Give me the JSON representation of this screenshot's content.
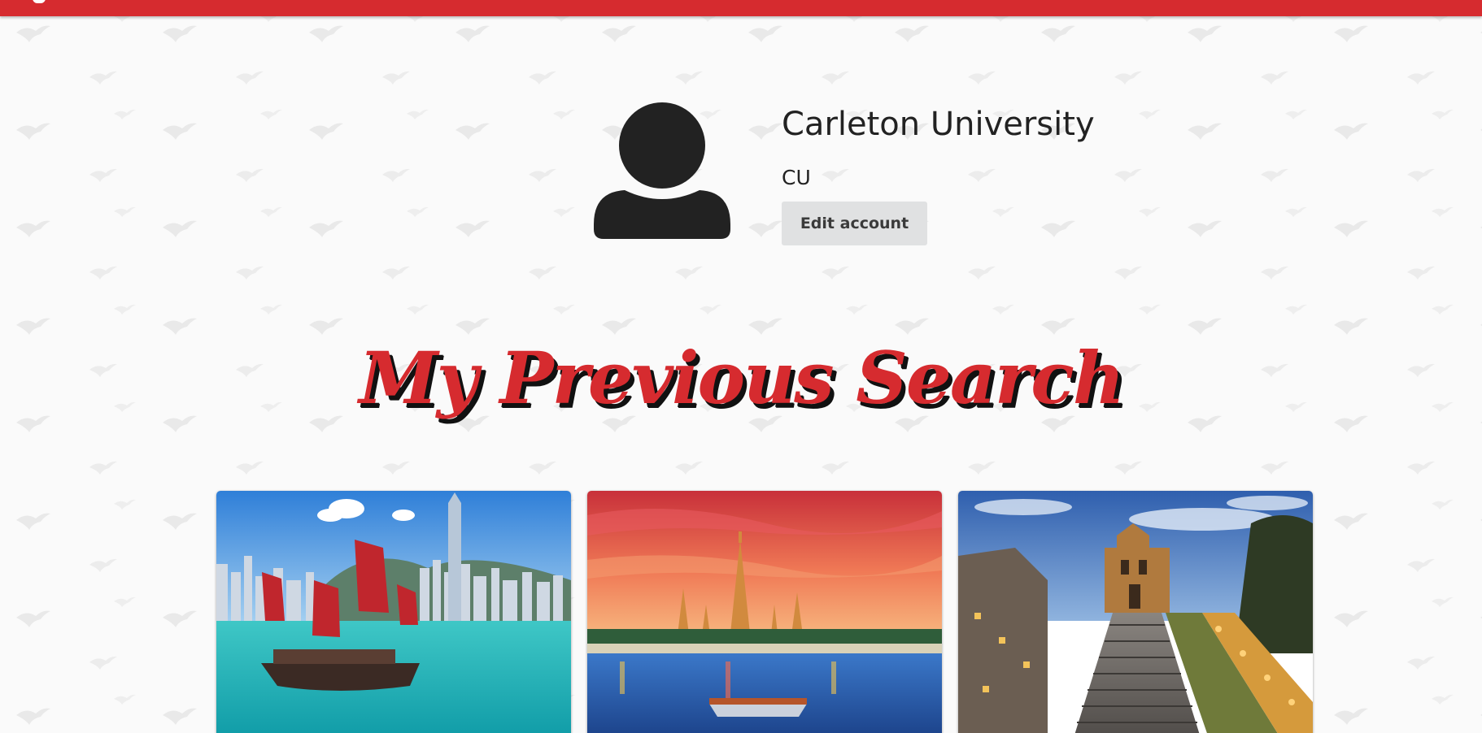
{
  "theme": {
    "accent": "#d62b2f",
    "background": "#fafafa",
    "text": "#222222",
    "button_bg": "#e0e1e2"
  },
  "profile": {
    "avatar_icon": "user-silhouette-icon",
    "name": "Carleton University",
    "abbreviation": "CU",
    "edit_button_label": "Edit account"
  },
  "section": {
    "title": "My Previous Search"
  },
  "searches": [
    {
      "scene": "harbour-skyline-with-red-sail-junk-boat"
    },
    {
      "scene": "temple-at-sunset-by-river"
    },
    {
      "scene": "stone-stairway-to-church-facade-at-dusk"
    }
  ]
}
